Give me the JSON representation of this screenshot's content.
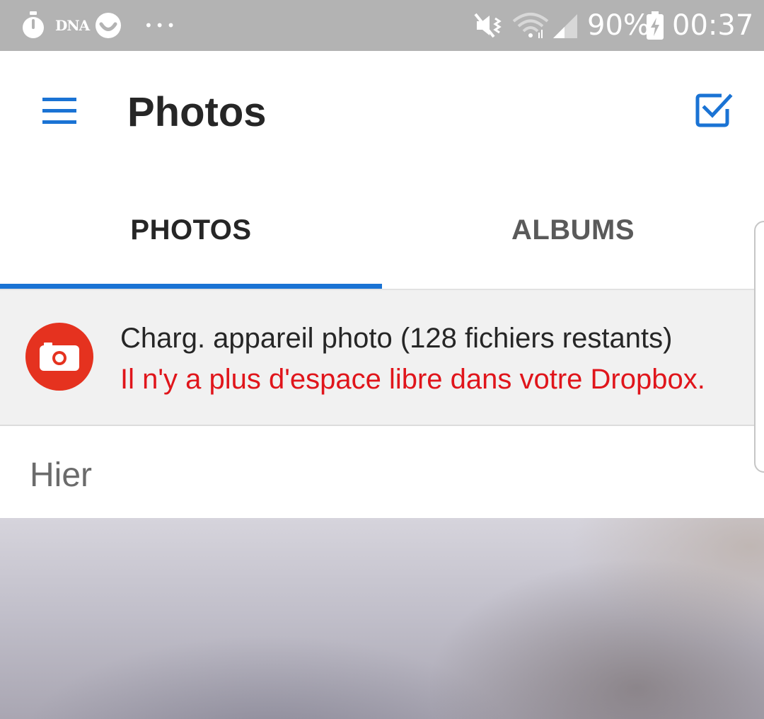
{
  "status_bar": {
    "dna_label": "DNA",
    "dots": "•••",
    "battery_percent": "90%",
    "time": "00:37",
    "icons": [
      "stopwatch-icon",
      "dna-icon",
      "smiley-icon",
      "more-dots-icon",
      "mute-vibrate-icon",
      "wifi-icon",
      "signal-icon",
      "battery-charging-icon"
    ]
  },
  "app_bar": {
    "title": "Photos",
    "icons": [
      "hamburger-menu-icon",
      "select-checkbox-icon"
    ],
    "accent": "#1a73d4"
  },
  "tabs": [
    {
      "label": "PHOTOS",
      "selected": true
    },
    {
      "label": "ALBUMS",
      "selected": false
    }
  ],
  "upload_banner": {
    "icon": "camera-icon",
    "title": "Charg. appareil photo (128 fichiers restants)",
    "error": "Il n'y a plus d'espace libre dans votre Dropbox.",
    "error_color": "#e0151b",
    "icon_bg": "#e5321f"
  },
  "section": {
    "header": "Hier"
  }
}
